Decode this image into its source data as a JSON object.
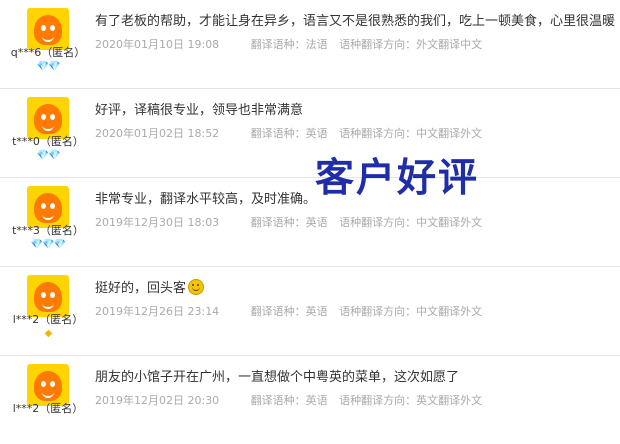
{
  "watermark": "客户好评",
  "reviews": [
    {
      "user": "q***6（匿名）",
      "level": "💎💎",
      "level_color": "#e4393c",
      "content": "有了老板的帮助，才能让身在异乡，语言又不是很熟悉的我们，吃上一顿美食，心里很温暖",
      "date": "2020年01月10日 19:08",
      "source_lang": "翻译语种：法语",
      "direction": "语种翻译方向：外文翻译中文"
    },
    {
      "user": "t***0（匿名）",
      "level": "💎💎",
      "level_color": "#e4393c",
      "content": "好评，译稿很专业，领导也非常满意",
      "date": "2020年01月02日 18:52",
      "source_lang": "翻译语种：英语",
      "direction": "语种翻译方向：中文翻译外文"
    },
    {
      "user": "t***3（匿名）",
      "level": "💎💎💎",
      "level_color": "#e4393c",
      "content": "非常专业，翻译水平较高，及时准确。",
      "date": "2019年12月30日 18:03",
      "source_lang": "翻译语种：英语",
      "direction": "语种翻译方向：中文翻译外文"
    },
    {
      "user": "l***2（匿名）",
      "level": "◆",
      "level_color": "#f2b600",
      "content": "挺好的，回头客",
      "emoji": "smile-emoji",
      "date": "2019年12月26日 23:14",
      "source_lang": "翻译语种：英语",
      "direction": "语种翻译方向：中文翻译外文"
    },
    {
      "user": "l***2（匿名）",
      "level": "",
      "level_color": "#f2b600",
      "content": "朋友的小馆子开在广州，一直想做个中粤英的菜单，这次如愿了",
      "date": "2019年12月02日 20:30",
      "source_lang": "翻译语种：英语",
      "direction": "语种翻译方向：英文翻译外文"
    }
  ]
}
